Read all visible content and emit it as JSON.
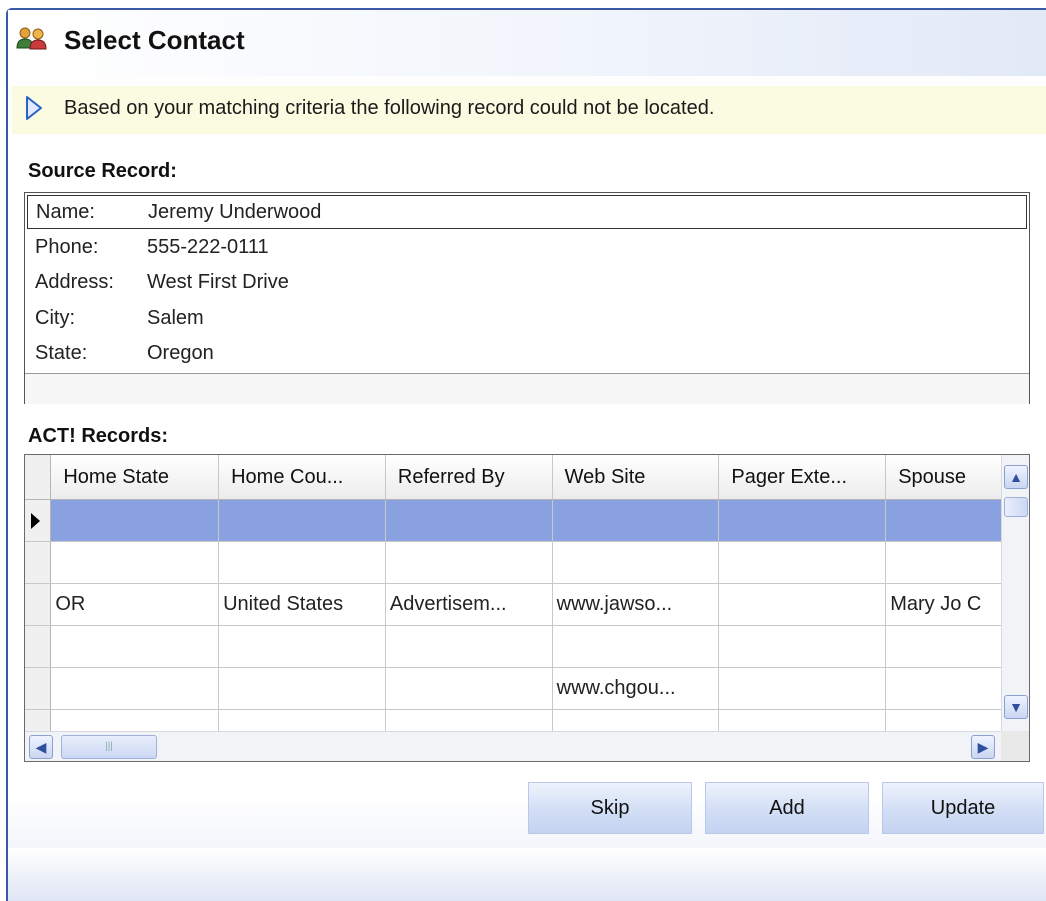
{
  "window": {
    "title": "Select Contact",
    "icon": "contacts-icon"
  },
  "info": {
    "icon": "info-arrow-icon",
    "message": "Based on your matching criteria the following record could not be located."
  },
  "source": {
    "heading": "Source Record:",
    "fields": [
      {
        "label": "Name:",
        "value": "Jeremy Underwood"
      },
      {
        "label": "Phone:",
        "value": "555-222-0111"
      },
      {
        "label": "Address:",
        "value": "West First Drive"
      },
      {
        "label": "City:",
        "value": "Salem"
      },
      {
        "label": "State:",
        "value": "Oregon"
      }
    ]
  },
  "records": {
    "heading": "ACT! Records:",
    "columns": [
      "Home State",
      "Home Cou...",
      "Referred By",
      "Web Site",
      "Pager Exte...",
      "Spouse"
    ],
    "rows": [
      [
        "",
        "",
        "",
        "",
        "",
        ""
      ],
      [
        "",
        "",
        "",
        "",
        "",
        ""
      ],
      [
        "OR",
        "United States",
        "Advertisem...",
        "www.jawso...",
        "",
        "Mary Jo C"
      ],
      [
        "",
        "",
        "",
        "",
        "",
        ""
      ],
      [
        "",
        "",
        "",
        "www.chgou...",
        "",
        ""
      ],
      [
        "",
        "",
        "",
        "",
        "",
        ""
      ]
    ],
    "selected_row": 0
  },
  "buttons": {
    "skip": "Skip",
    "add": "Add",
    "update": "Update"
  },
  "colors": {
    "selection": "#8aa1e1",
    "accent": "#3a5aa8",
    "info_bg": "#fbfbe2"
  }
}
